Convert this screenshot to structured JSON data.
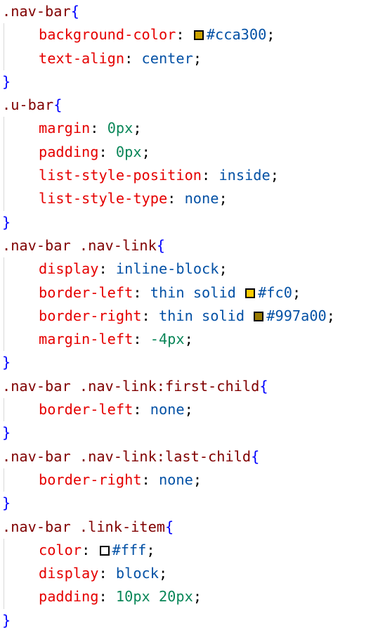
{
  "code": {
    "rules": [
      {
        "selector": ".nav-bar",
        "declarations": [
          {
            "prop": "background-color",
            "parts": [
              {
                "type": "swatch",
                "color": "#cca300"
              },
              {
                "type": "kw",
                "text": "#cca300"
              }
            ]
          },
          {
            "prop": "text-align",
            "parts": [
              {
                "type": "kw",
                "text": "center"
              }
            ]
          }
        ]
      },
      {
        "selector": ".u-bar",
        "declarations": [
          {
            "prop": "margin",
            "parts": [
              {
                "type": "num",
                "text": "0px"
              }
            ]
          },
          {
            "prop": "padding",
            "parts": [
              {
                "type": "num",
                "text": "0px"
              }
            ]
          },
          {
            "prop": "list-style-position",
            "parts": [
              {
                "type": "kw",
                "text": "inside"
              }
            ]
          },
          {
            "prop": "list-style-type",
            "parts": [
              {
                "type": "kw",
                "text": "none"
              }
            ]
          }
        ]
      },
      {
        "selector": ".nav-bar .nav-link",
        "declarations": [
          {
            "prop": "display",
            "parts": [
              {
                "type": "kw",
                "text": "inline-block"
              }
            ]
          },
          {
            "prop": "border-left",
            "parts": [
              {
                "type": "kw",
                "text": "thin solid "
              },
              {
                "type": "swatch",
                "color": "#ffcc00"
              },
              {
                "type": "kw",
                "text": "#fc0"
              }
            ]
          },
          {
            "prop": "border-right",
            "parts": [
              {
                "type": "kw",
                "text": "thin solid "
              },
              {
                "type": "swatch",
                "color": "#997a00"
              },
              {
                "type": "kw",
                "text": "#997a00"
              }
            ]
          },
          {
            "prop": "margin-left",
            "parts": [
              {
                "type": "num",
                "text": "-4px"
              }
            ]
          }
        ]
      },
      {
        "selector": ".nav-bar .nav-link:first-child",
        "declarations": [
          {
            "prop": "border-left",
            "parts": [
              {
                "type": "kw",
                "text": "none"
              }
            ]
          }
        ]
      },
      {
        "selector": ".nav-bar .nav-link:last-child",
        "declarations": [
          {
            "prop": "border-right",
            "parts": [
              {
                "type": "kw",
                "text": "none"
              }
            ]
          }
        ]
      },
      {
        "selector": ".nav-bar .link-item",
        "declarations": [
          {
            "prop": "color",
            "parts": [
              {
                "type": "swatch",
                "color": "#ffffff"
              },
              {
                "type": "kw",
                "text": "#fff"
              }
            ]
          },
          {
            "prop": "display",
            "parts": [
              {
                "type": "kw",
                "text": "block"
              }
            ]
          },
          {
            "prop": "padding",
            "parts": [
              {
                "type": "num",
                "text": "10px 20px"
              }
            ]
          }
        ]
      }
    ],
    "open_brace": "{",
    "close_brace": "}",
    "colon": ":",
    "semicolon": ";"
  }
}
